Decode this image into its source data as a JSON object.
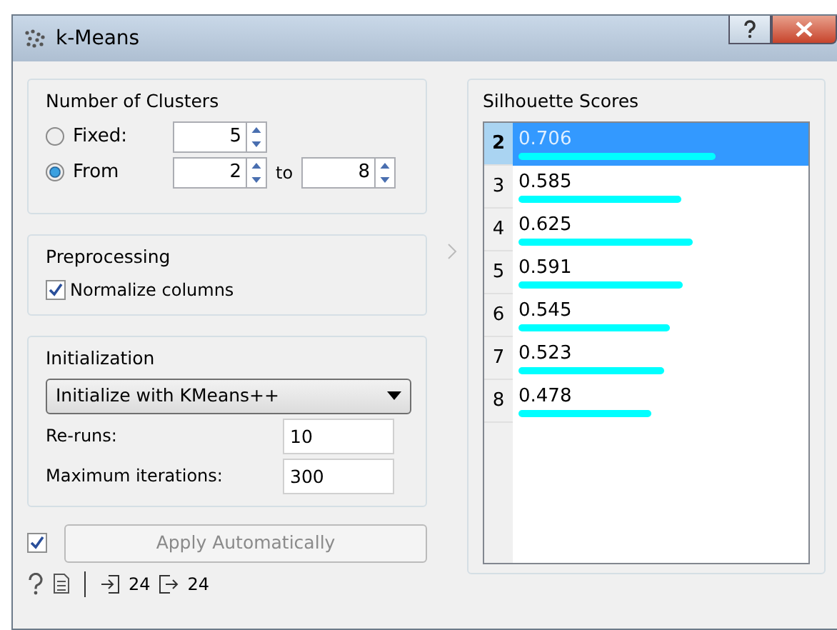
{
  "window": {
    "title": "k-Means"
  },
  "number_of_clusters": {
    "title": "Number of Clusters",
    "fixed": {
      "label": "Fixed:",
      "selected": false,
      "value": "5"
    },
    "range": {
      "label": "From",
      "selected": true,
      "from": "2",
      "to_label": "to",
      "to": "8"
    }
  },
  "preprocessing": {
    "title": "Preprocessing",
    "normalize": {
      "label": "Normalize columns",
      "checked": true
    }
  },
  "initialization": {
    "title": "Initialization",
    "method": "Initialize with KMeans++",
    "reruns": {
      "label": "Re-runs:",
      "value": "10"
    },
    "max_iterations": {
      "label": "Maximum iterations:",
      "value": "300"
    }
  },
  "apply": {
    "checked": true,
    "label": "Apply Automatically",
    "disabled": true
  },
  "status_bar": {
    "input_count": "24",
    "output_count": "24"
  },
  "silhouette": {
    "title": "Silhouette Scores",
    "rows": [
      {
        "index": "2",
        "score": "0.706",
        "level": 0.706,
        "selected": true
      },
      {
        "index": "3",
        "score": "0.585",
        "level": 0.585,
        "selected": false
      },
      {
        "index": "4",
        "score": "0.625",
        "level": 0.625,
        "selected": false
      },
      {
        "index": "5",
        "score": "0.591",
        "level": 0.591,
        "selected": false
      },
      {
        "index": "6",
        "score": "0.545",
        "level": 0.545,
        "selected": false
      },
      {
        "index": "7",
        "score": "0.523",
        "level": 0.523,
        "selected": false
      },
      {
        "index": "8",
        "score": "0.478",
        "level": 0.478,
        "selected": false
      }
    ]
  }
}
